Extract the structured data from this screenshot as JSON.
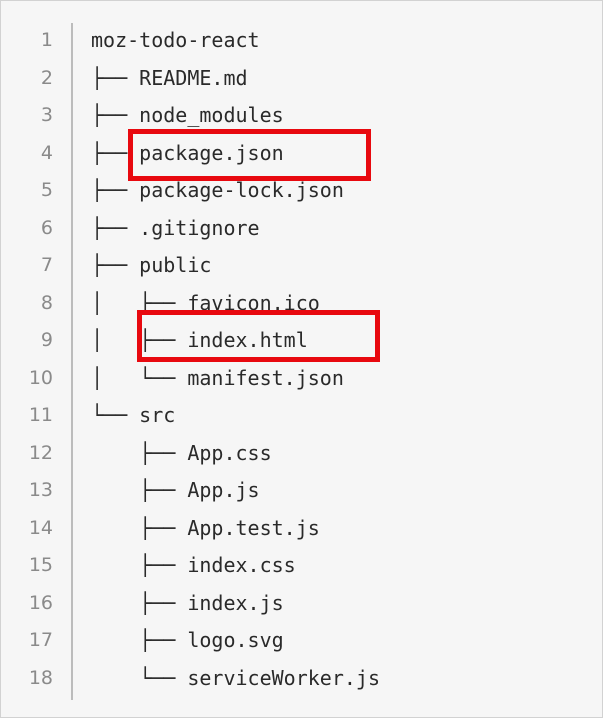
{
  "file_tree": {
    "lines": [
      {
        "number": "1",
        "text": "moz-todo-react"
      },
      {
        "number": "2",
        "text": "├── README.md"
      },
      {
        "number": "3",
        "text": "├── node_modules"
      },
      {
        "number": "4",
        "text": "├── package.json"
      },
      {
        "number": "5",
        "text": "├── package-lock.json"
      },
      {
        "number": "6",
        "text": "├── .gitignore"
      },
      {
        "number": "7",
        "text": "├── public"
      },
      {
        "number": "8",
        "text": "│   ├── favicon.ico"
      },
      {
        "number": "9",
        "text": "│   ├── index.html"
      },
      {
        "number": "10",
        "text": "│   └── manifest.json"
      },
      {
        "number": "11",
        "text": "└── src"
      },
      {
        "number": "12",
        "text": "    ├── App.css"
      },
      {
        "number": "13",
        "text": "    ├── App.js"
      },
      {
        "number": "14",
        "text": "    ├── App.test.js"
      },
      {
        "number": "15",
        "text": "    ├── index.css"
      },
      {
        "number": "16",
        "text": "    ├── index.js"
      },
      {
        "number": "17",
        "text": "    ├── logo.svg"
      },
      {
        "number": "18",
        "text": "    └── serviceWorker.js"
      }
    ]
  },
  "highlight_color": "#e8090f"
}
